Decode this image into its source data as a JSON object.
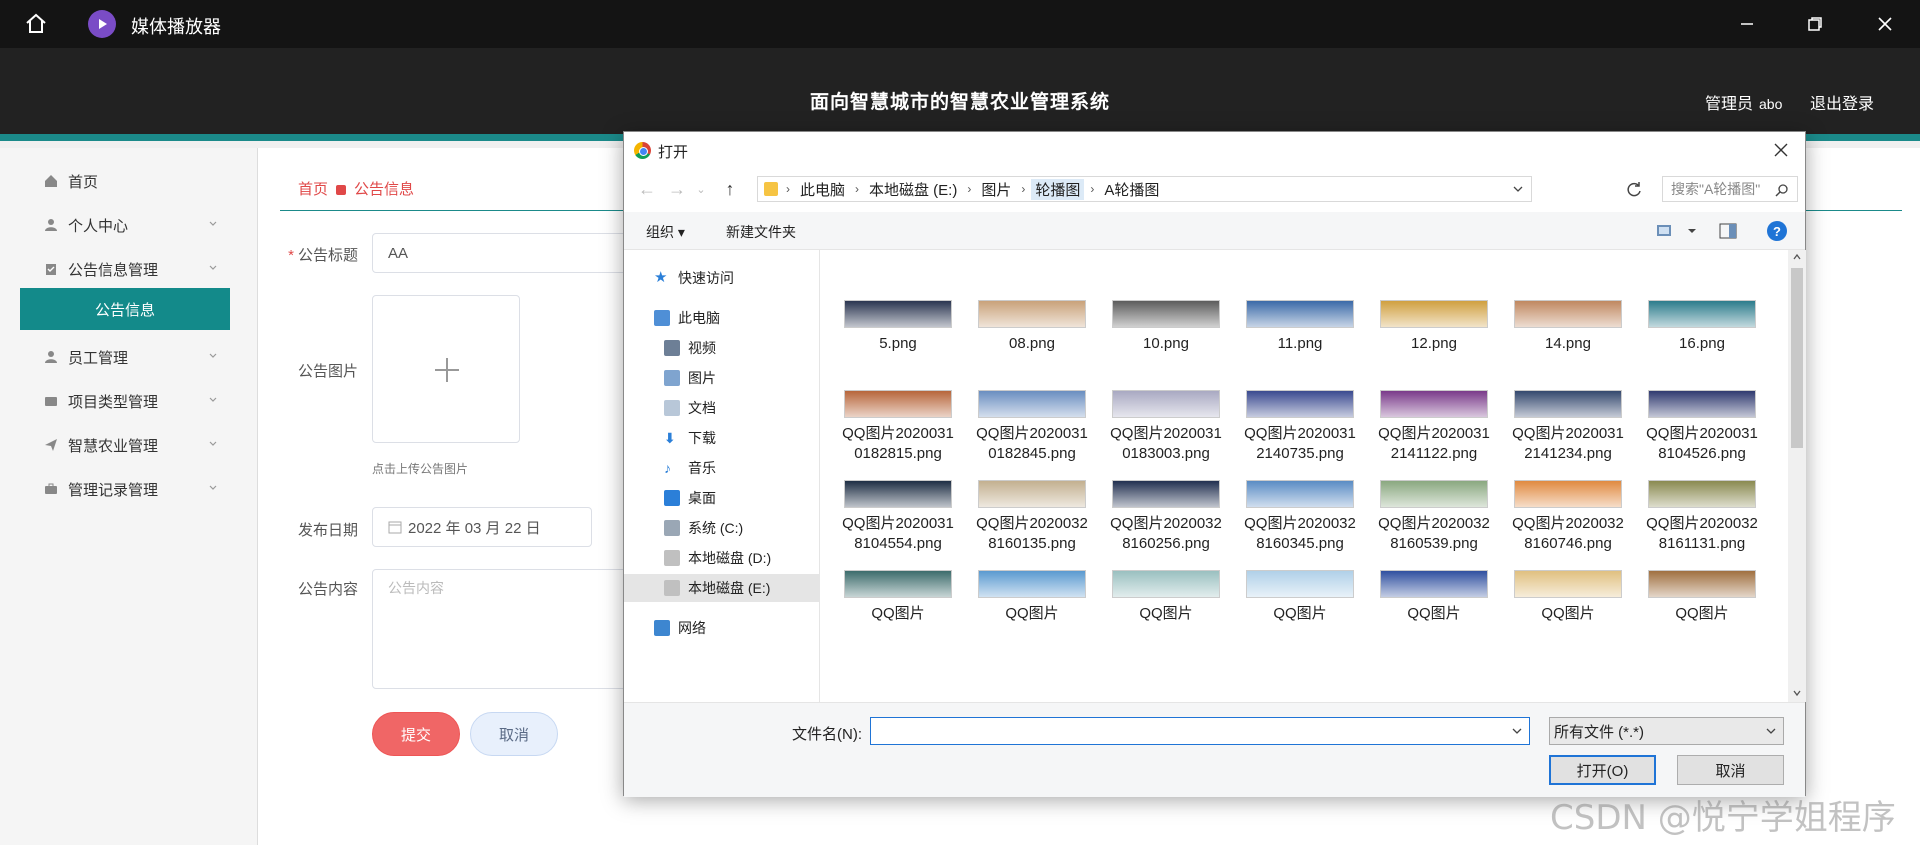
{
  "window": {
    "title": "媒体播放器",
    "minimize": "—",
    "maximize": "❐",
    "close": "✕"
  },
  "header": {
    "system_title": "面向智慧城市的智慧农业管理系统",
    "admin_label": "管理员",
    "admin_name": "abo",
    "logout": "退出登录"
  },
  "sidebar": {
    "items": [
      {
        "label": "首页"
      },
      {
        "label": "个人中心"
      },
      {
        "label": "公告信息管理"
      },
      {
        "label": "公告信息"
      },
      {
        "label": "员工管理"
      },
      {
        "label": "项目类型管理"
      },
      {
        "label": "智慧农业管理"
      },
      {
        "label": "管理记录管理"
      }
    ]
  },
  "breadcrumb": {
    "home": "首页",
    "current": "公告信息"
  },
  "form": {
    "title_label": "公告标题",
    "required_mark": "*",
    "title_value": "AA",
    "image_label": "公告图片",
    "upload_hint": "点击上传公告图片",
    "date_label": "发布日期",
    "date_value": "2022 年 03 月 22 日",
    "content_label": "公告内容",
    "content_placeholder": "公告内容",
    "submit": "提交",
    "cancel": "取消"
  },
  "dialog": {
    "title": "打开",
    "path": [
      "此电脑",
      "本地磁盘 (E:)",
      "图片",
      "轮播图",
      "A轮播图"
    ],
    "search_placeholder": "搜索\"A轮播图\"",
    "organize": "组织 ▾",
    "new_folder": "新建文件夹",
    "help": "?",
    "nav": {
      "quick_access": "快速访问",
      "this_pc": "此电脑",
      "videos": "视频",
      "pictures": "图片",
      "documents": "文档",
      "downloads": "下载",
      "music": "音乐",
      "desktop": "桌面",
      "drive_c": "系统 (C:)",
      "drive_d": "本地磁盘 (D:)",
      "drive_e": "本地磁盘 (E:)",
      "network": "网络"
    },
    "files": [
      {
        "name": "5.png",
        "color": "#2a3550"
      },
      {
        "name": "08.png",
        "color": "#c9a27a"
      },
      {
        "name": "10.png",
        "color": "#5c5c5c"
      },
      {
        "name": "11.png",
        "color": "#3b6aa8"
      },
      {
        "name": "12.png",
        "color": "#d0a040"
      },
      {
        "name": "14.png",
        "color": "#c08860"
      },
      {
        "name": "16.png",
        "color": "#2c7c8c"
      },
      {
        "name": "QQ图片20200310182815.png",
        "color": "#b7663b"
      },
      {
        "name": "QQ图片20200310182845.png",
        "color": "#6a8ec0"
      },
      {
        "name": "QQ图片20200310183003.png",
        "color": "#a9a9c2"
      },
      {
        "name": "QQ图片20200312140735.png",
        "color": "#3a4a90"
      },
      {
        "name": "QQ图片20200312141122.png",
        "color": "#7a3a8a"
      },
      {
        "name": "QQ图片20200312141234.png",
        "color": "#34486e"
      },
      {
        "name": "QQ图片20200318104526.png",
        "color": "#303a70"
      },
      {
        "name": "QQ图片20200318104554.png",
        "color": "#1e2e44"
      },
      {
        "name": "QQ图片20200328160135.png",
        "color": "#c3b090"
      },
      {
        "name": "QQ图片20200328160256.png",
        "color": "#223050"
      },
      {
        "name": "QQ图片20200328160345.png",
        "color": "#5a8cc4"
      },
      {
        "name": "QQ图片20200328160539.png",
        "color": "#8aa880"
      },
      {
        "name": "QQ图片20200328160746.png",
        "color": "#e08a40"
      },
      {
        "name": "QQ图片20200328161131.png",
        "color": "#8a8a50"
      },
      {
        "name": "QQ图片",
        "color": "#3c6c6c"
      },
      {
        "name": "QQ图片",
        "color": "#5a9ad0"
      },
      {
        "name": "QQ图片",
        "color": "#9ac0c0"
      },
      {
        "name": "QQ图片",
        "color": "#b0d0e8"
      },
      {
        "name": "QQ图片",
        "color": "#3050a0"
      },
      {
        "name": "QQ图片",
        "color": "#e0c080"
      },
      {
        "name": "QQ图片",
        "color": "#a07040"
      }
    ],
    "filename_label": "文件名(N):",
    "filename_value": "",
    "filetype": "所有文件 (*.*)",
    "open_button": "打开(O)",
    "cancel_button": "取消"
  },
  "watermark": "CSDN @悦宁学姐程序"
}
